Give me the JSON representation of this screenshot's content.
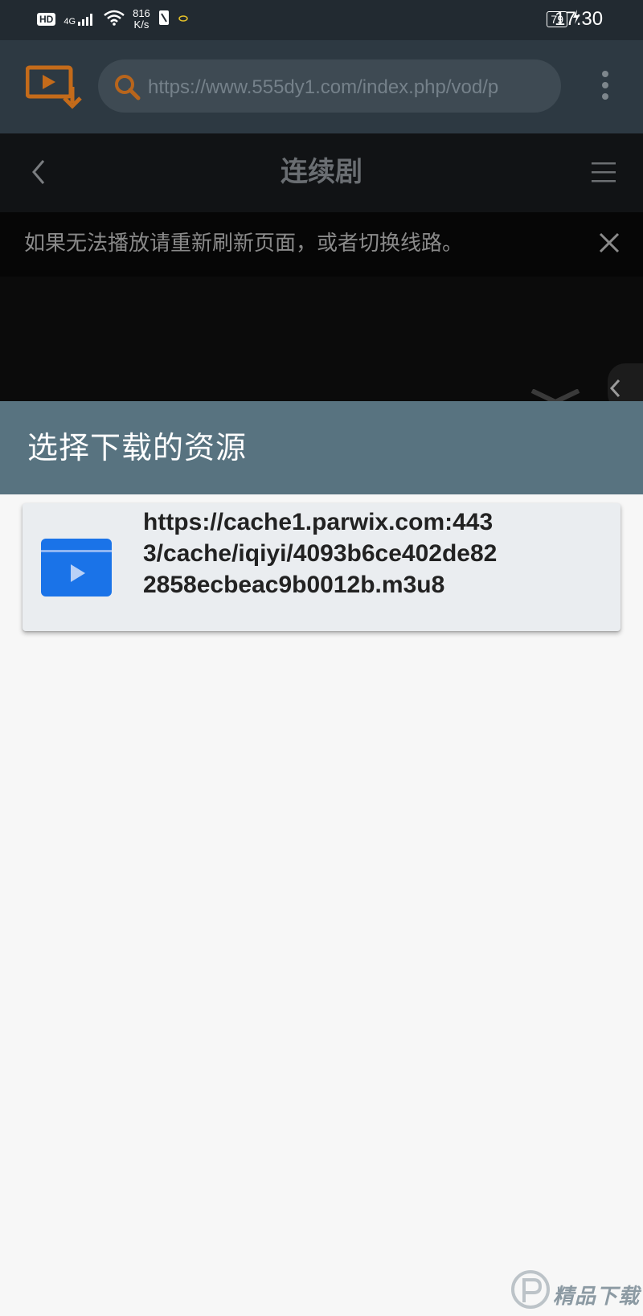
{
  "status_bar": {
    "hd_badge": "HD",
    "network": "4G",
    "speed_value": "816",
    "speed_unit": "K/s",
    "battery": "79",
    "time": "17:30"
  },
  "browser": {
    "url": "https://www.555dy1.com/index.php/vod/p",
    "icons": [
      "video-download-app-icon",
      "search-icon",
      "more-vert-icon"
    ]
  },
  "page": {
    "title": "连续剧",
    "notice": "如果无法播放请重新刷新页面，或者切换线路。"
  },
  "dialog": {
    "title": "选择下载的资源",
    "items": [
      {
        "url": "https://cache1.parwix.com:4433/cache/iqiyi/4093b6ce402de822858ecbeac9b0012b.m3u8"
      }
    ]
  },
  "watermark": {
    "text": "精品下载"
  },
  "colors": {
    "status_bar": "#222a31",
    "browser_bar": "#2d3942",
    "dialog_header": "#587380",
    "card_bg": "#eaedf0",
    "video_icon": "#1a73e8",
    "app_icon": "#d4761c"
  }
}
